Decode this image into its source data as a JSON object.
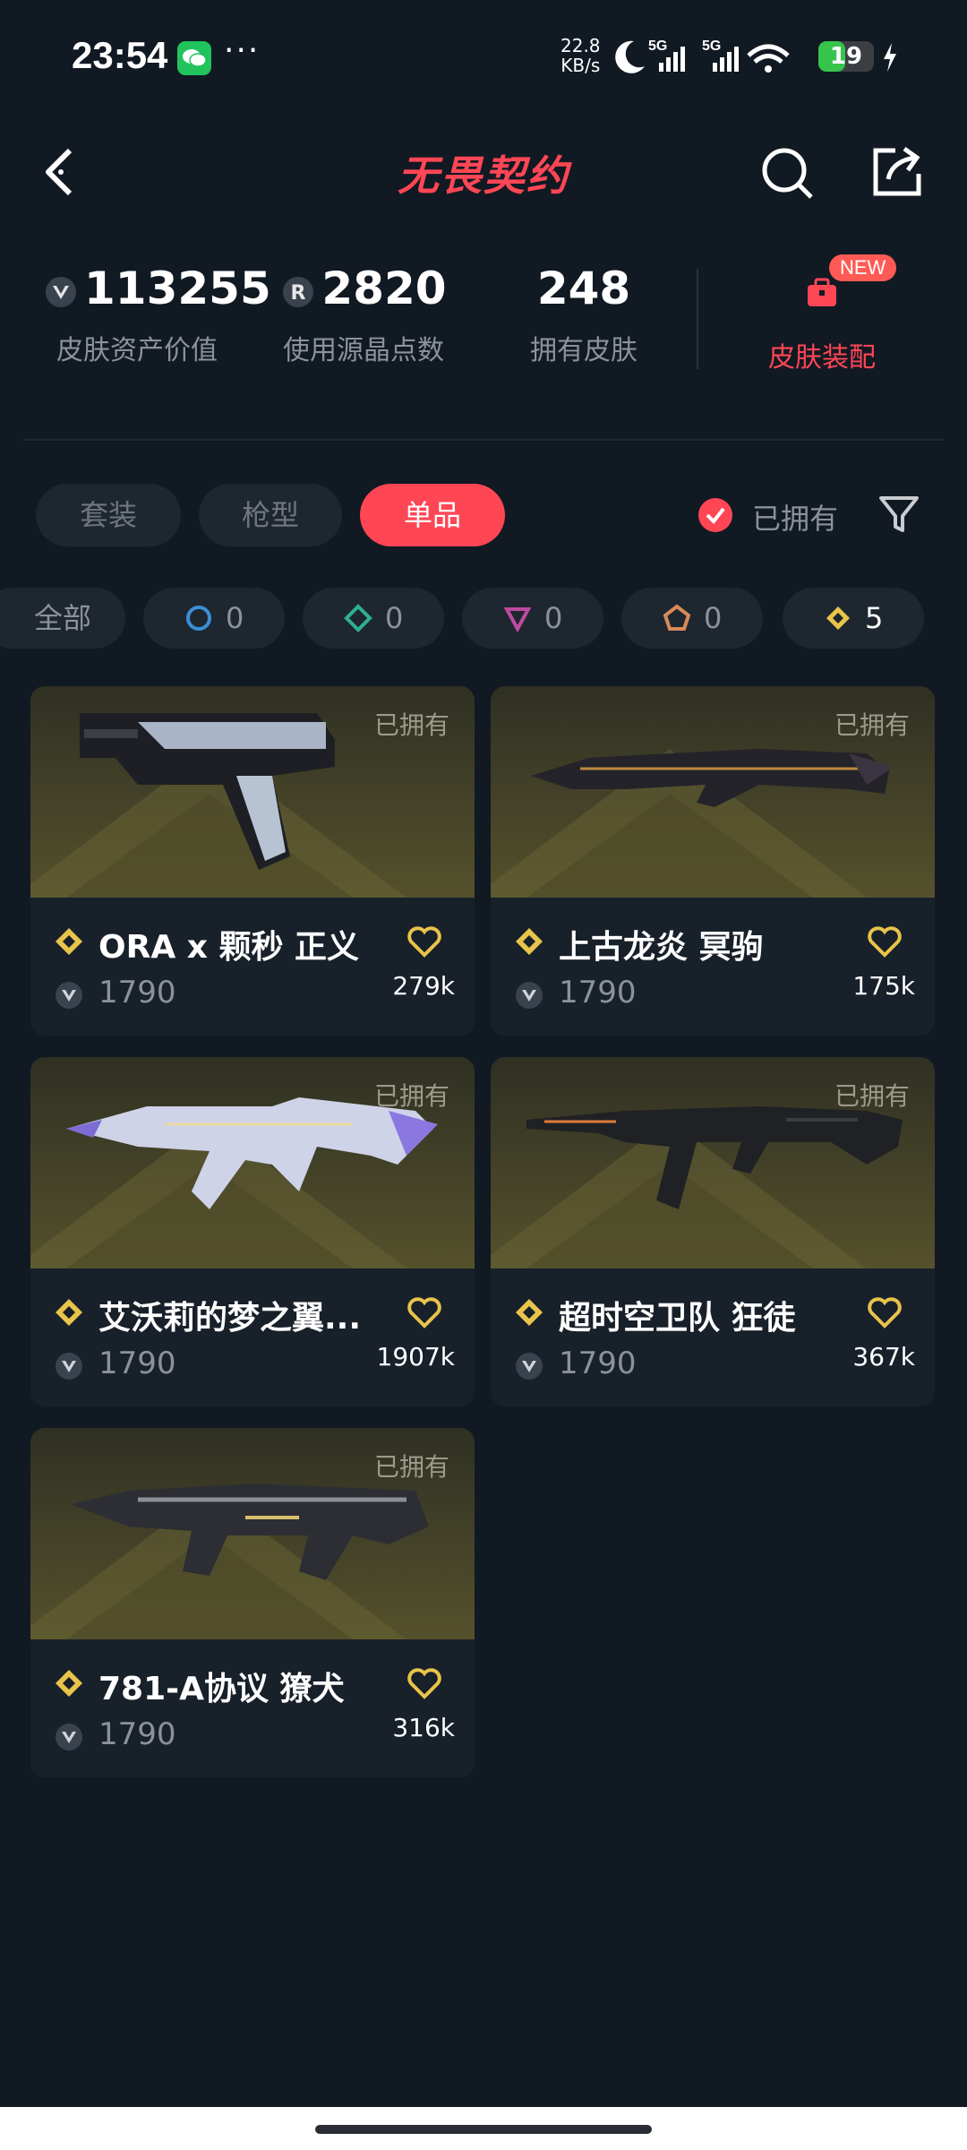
{
  "status_bar": {
    "time": "23:54",
    "net_speed_value": "22.8",
    "net_speed_unit": "KB/s",
    "signal_1": "5G",
    "signal_2": "5G",
    "battery": "19"
  },
  "header": {
    "title": "无畏契约"
  },
  "stats": [
    {
      "value": "113255",
      "label": "皮肤资产价值"
    },
    {
      "value": "2820",
      "label": "使用源晶点数"
    },
    {
      "value": "248",
      "label": "拥有皮肤"
    }
  ],
  "loadout": {
    "label": "皮肤装配",
    "badge": "NEW"
  },
  "tabs": [
    {
      "label": "套装",
      "active": false
    },
    {
      "label": "枪型",
      "active": false
    },
    {
      "label": "单品",
      "active": true
    }
  ],
  "owned_toggle": {
    "label": "已拥有",
    "checked": true
  },
  "tier_chips": [
    {
      "label": "全部"
    },
    {
      "count": "0",
      "tier_color": "#3a8fd6"
    },
    {
      "count": "0",
      "tier_color": "#2fb08e"
    },
    {
      "count": "0",
      "tier_color": "#c04a9f"
    },
    {
      "count": "0",
      "tier_color": "#d98a57"
    },
    {
      "count": "5",
      "tier_color": "#e8c44a"
    }
  ],
  "skins": [
    {
      "name": "ORA x 颗秒 正义",
      "price": "1790",
      "likes": "279k",
      "owned": "已拥有"
    },
    {
      "name": "上古龙炎 冥驹",
      "price": "1790",
      "likes": "175k",
      "owned": "已拥有"
    },
    {
      "name": "艾沃莉的梦之翼...",
      "price": "1790",
      "likes": "1907k",
      "owned": "已拥有"
    },
    {
      "name": "超时空卫队 狂徒",
      "price": "1790",
      "likes": "367k",
      "owned": "已拥有"
    },
    {
      "name": "781-A协议 獠犬",
      "price": "1790",
      "likes": "316k",
      "owned": "已拥有"
    }
  ],
  "colors": {
    "background": "#111923",
    "accent": "#ff4655",
    "gold": "#e8c44a"
  }
}
